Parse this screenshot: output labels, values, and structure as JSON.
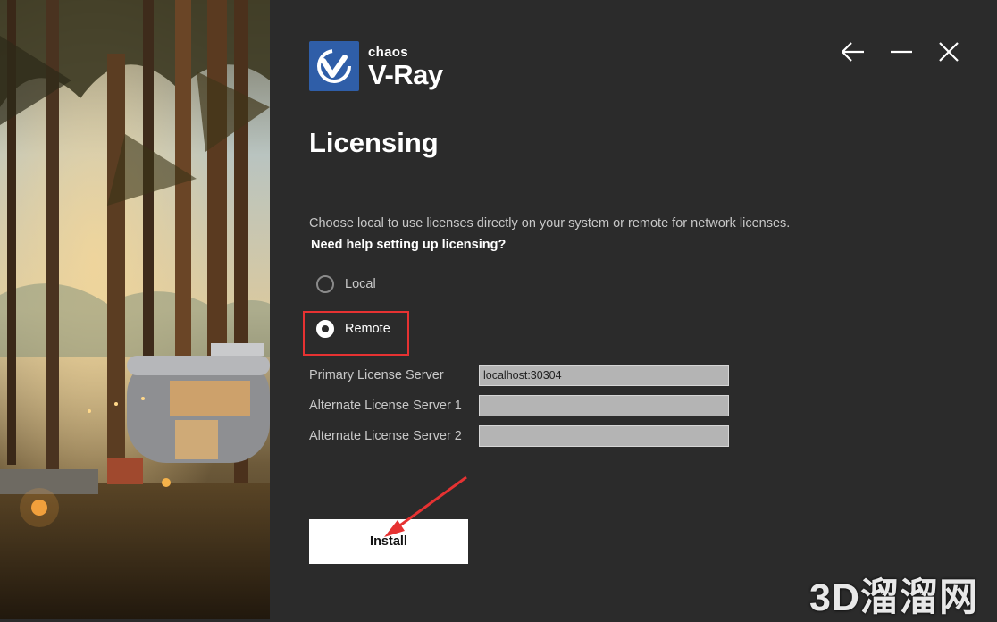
{
  "logo": {
    "brand": "chaos",
    "product": "V-Ray"
  },
  "window": {
    "back_icon": "arrow-left-icon",
    "minimize_icon": "minimize-icon",
    "close_icon": "close-icon"
  },
  "page": {
    "title": "Licensing",
    "description": "Choose local to use licenses directly on your system or remote for network licenses.",
    "help_link": "Need help setting up licensing?"
  },
  "license_mode": {
    "options": [
      {
        "label": "Local",
        "selected": false
      },
      {
        "label": "Remote",
        "selected": true
      }
    ]
  },
  "servers": [
    {
      "label": "Primary License Server",
      "value": "localhost:30304"
    },
    {
      "label": "Alternate License Server 1",
      "value": ""
    },
    {
      "label": "Alternate License Server 2",
      "value": ""
    }
  ],
  "install_label": "Install",
  "watermark": "3D溜溜网",
  "colors": {
    "accent": "#2f5ea8",
    "annotation": "#e63232",
    "panel_bg": "#2b2b2b"
  }
}
